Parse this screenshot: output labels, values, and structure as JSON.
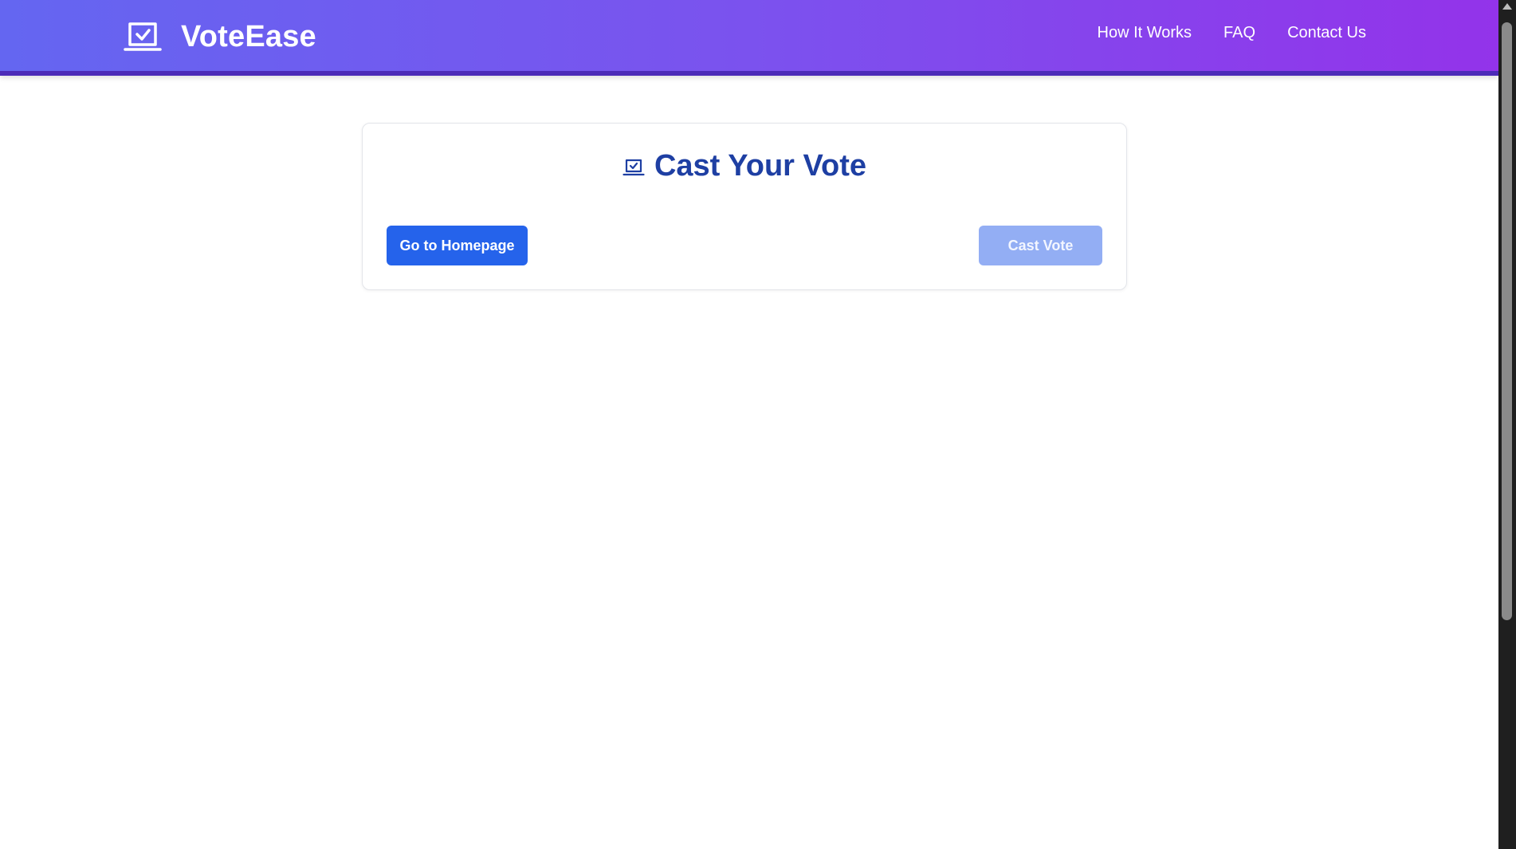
{
  "header": {
    "brand_name": "VoteEase",
    "brand_icon": "ballot-box-check-icon",
    "nav": [
      {
        "label": "How It Works"
      },
      {
        "label": "FAQ"
      },
      {
        "label": "Contact Us"
      }
    ],
    "gradient_start": "#6466f1",
    "gradient_end": "#9333ea"
  },
  "card": {
    "title": "Cast Your Vote",
    "title_icon": "ballot-box-check-icon",
    "home_button_label": "Go to Homepage",
    "cast_button_label": "Cast Vote",
    "cast_button_disabled": true
  },
  "colors": {
    "primary": "#2563eb",
    "primary_disabled": "#93aef4",
    "title": "#1e3fa3"
  }
}
